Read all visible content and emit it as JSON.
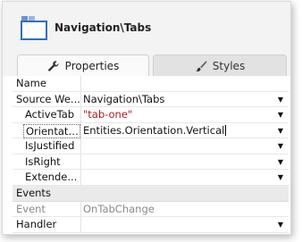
{
  "header": {
    "title": "Navigation\\Tabs"
  },
  "tabs": [
    {
      "label": "Properties",
      "icon": "wrench-icon",
      "active": true
    },
    {
      "label": "Styles",
      "icon": "brush-icon",
      "active": false
    }
  ],
  "properties": [
    {
      "name": "Name",
      "value": ""
    },
    {
      "name": "Source We...",
      "value": "Navigation\\Tabs"
    },
    {
      "name": "ActiveTab",
      "value": "\"tab-one\""
    },
    {
      "name": "Orientati...",
      "value": "Entities.Orientation.Vertical"
    },
    {
      "name": "IsJustified",
      "value": ""
    },
    {
      "name": "IsRight",
      "value": ""
    },
    {
      "name": "Extende...",
      "value": ""
    }
  ],
  "events_section": {
    "label": "Events",
    "rows": [
      {
        "name": "Event",
        "value": "OnTabChange"
      },
      {
        "name": "Handler",
        "value": ""
      }
    ]
  },
  "colors": {
    "accent_blue": "#2f6fc0",
    "string_red": "#b01a1a",
    "muted_grey": "#8a8a8a"
  }
}
